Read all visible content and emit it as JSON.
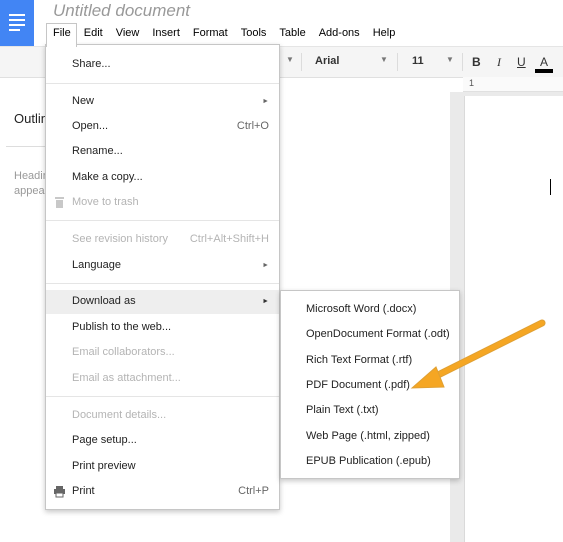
{
  "document": {
    "title": "Untitled document"
  },
  "menubar": [
    "File",
    "Edit",
    "View",
    "Insert",
    "Format",
    "Tools",
    "Table",
    "Add-ons",
    "Help"
  ],
  "toolbar": {
    "font": "Arial",
    "font_size": "11",
    "bold": "B",
    "italic": "I",
    "underline": "U",
    "text_color": "A",
    "ruler_number": "1"
  },
  "sidebar": {
    "outline_title": "Outlin",
    "hint_line1": "Headin",
    "hint_line2": "appea"
  },
  "file_menu": {
    "share": "Share...",
    "new": "New",
    "open": "Open...",
    "open_shortcut": "Ctrl+O",
    "rename": "Rename...",
    "make_copy": "Make a copy...",
    "move_to_trash": "Move to trash",
    "revision_history": "See revision history",
    "revision_shortcut": "Ctrl+Alt+Shift+H",
    "language": "Language",
    "download_as": "Download as",
    "publish": "Publish to the web...",
    "email_collaborators": "Email collaborators...",
    "email_attachment": "Email as attachment...",
    "document_details": "Document details...",
    "page_setup": "Page setup...",
    "print_preview": "Print preview",
    "print": "Print",
    "print_shortcut": "Ctrl+P"
  },
  "download_submenu": [
    "Microsoft Word (.docx)",
    "OpenDocument Format (.odt)",
    "Rich Text Format (.rtf)",
    "PDF Document (.pdf)",
    "Plain Text (.txt)",
    "Web Page (.html, zipped)",
    "EPUB Publication (.epub)"
  ],
  "colors": {
    "brand": "#4285f4",
    "highlight": "#eeeeee",
    "annotation_arrow": "#f5a623"
  }
}
